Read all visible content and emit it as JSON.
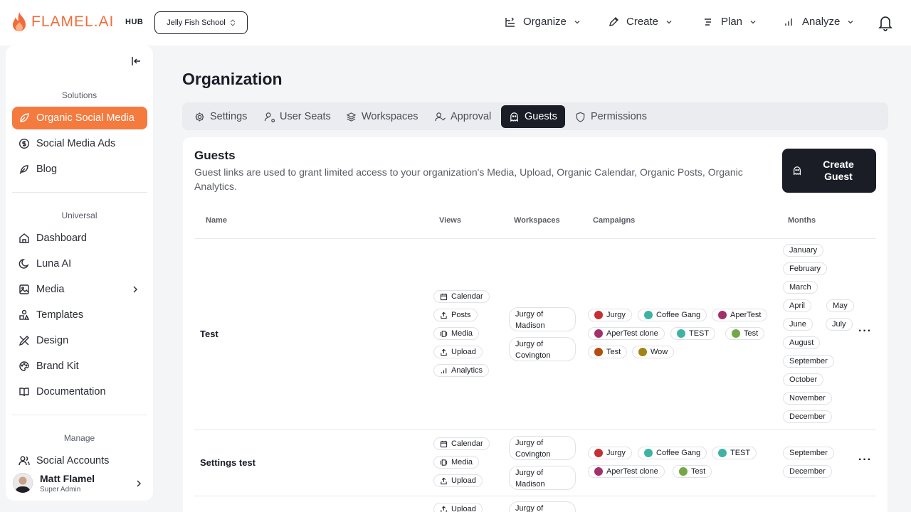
{
  "brand": {
    "name": "FLAMEL.AI",
    "hub": "HUB",
    "accent": "#f47a3e",
    "dark": "#1a1d26"
  },
  "workspace_select": {
    "value": "Jelly Fish School"
  },
  "topnav": {
    "organize": "Organize",
    "create": "Create",
    "plan": "Plan",
    "analyze": "Analyze"
  },
  "sidebar": {
    "solutions_label": "Solutions",
    "solutions": [
      "Organic Social Media",
      "Social Media Ads",
      "Blog"
    ],
    "universal_label": "Universal",
    "universal": [
      "Dashboard",
      "Luna AI",
      "Media",
      "Templates",
      "Design",
      "Brand Kit",
      "Documentation"
    ],
    "manage_label": "Manage",
    "manage": [
      "Social Accounts"
    ],
    "user": {
      "name": "Matt Flamel",
      "role": "Super Admin"
    }
  },
  "page": {
    "title": "Organization"
  },
  "tabs": [
    "Settings",
    "User Seats",
    "Workspaces",
    "Approval",
    "Guests",
    "Permissions"
  ],
  "guests": {
    "title": "Guests",
    "description": "Guest links are used to grant limited access to your organization's Media, Upload, Organic Calendar, Organic Posts, Organic Analytics.",
    "create_button": "Create Guest",
    "columns": [
      "Name",
      "Views",
      "Workspaces",
      "Campaigns",
      "Months"
    ],
    "rows": [
      {
        "name": "Test",
        "views": [
          "Calendar",
          "Posts",
          "Media",
          "Upload",
          "Analytics"
        ],
        "workspaces": [
          "Jurgy of Madison",
          "Jurgy of Covington"
        ],
        "campaigns": [
          {
            "name": "Jurgy",
            "color": "#c62f33"
          },
          {
            "name": "Coffee Gang",
            "color": "#3fb3a3"
          },
          {
            "name": "AperTest",
            "color": "#a3306a"
          },
          {
            "name": "AperTest clone",
            "color": "#a3306a"
          },
          {
            "name": "TEST",
            "color": "#3fb3a3"
          },
          {
            "name": "Test",
            "color": "#72a845"
          },
          {
            "name": "Test",
            "color": "#b54e0e"
          },
          {
            "name": "Wow",
            "color": "#a08418"
          }
        ],
        "months": [
          "January",
          "February",
          "March",
          "April",
          "May",
          "June",
          "July",
          "August",
          "September",
          "October",
          "November",
          "December"
        ]
      },
      {
        "name": "Settings test",
        "views": [
          "Calendar",
          "Media",
          "Upload"
        ],
        "workspaces": [
          "Jurgy of Covington",
          "Jurgy of Madison"
        ],
        "campaigns": [
          {
            "name": "Jurgy",
            "color": "#c62f33"
          },
          {
            "name": "Coffee Gang",
            "color": "#3fb3a3"
          },
          {
            "name": "TEST",
            "color": "#3fb3a3"
          },
          {
            "name": "AperTest clone",
            "color": "#a3306a"
          },
          {
            "name": "Test",
            "color": "#72a845"
          }
        ],
        "months": [
          "September",
          "December"
        ]
      },
      {
        "name": "",
        "views": [
          "Upload"
        ],
        "workspaces": [
          "Jurgy of"
        ],
        "campaigns": [],
        "months": []
      }
    ]
  }
}
